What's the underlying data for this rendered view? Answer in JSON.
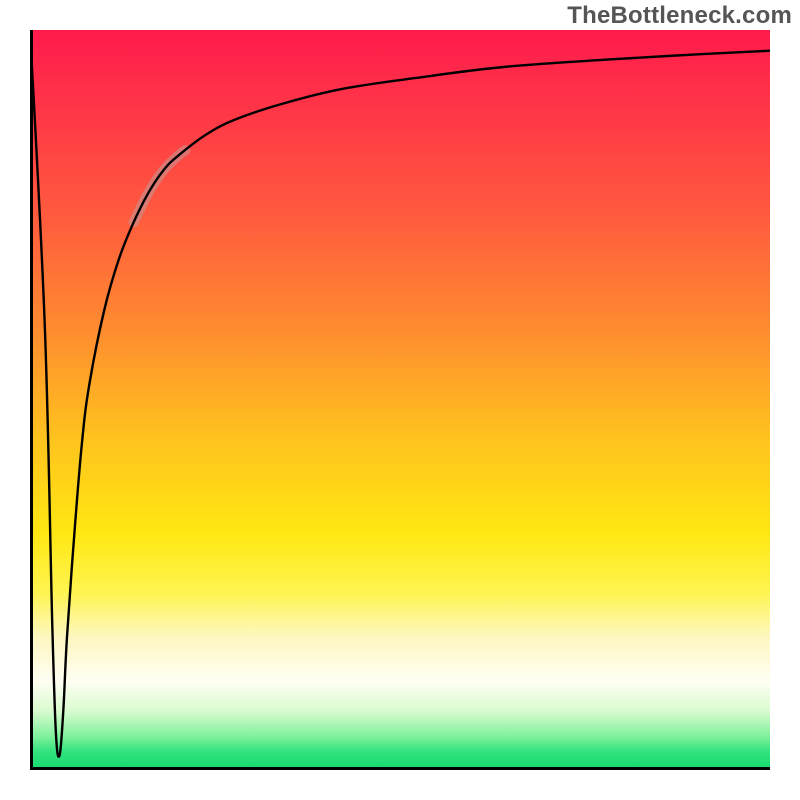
{
  "watermark": "TheBottleneck.com",
  "chart_data": {
    "type": "line",
    "title": "",
    "xlabel": "",
    "ylabel": "",
    "xlim": [
      0,
      100
    ],
    "ylim": [
      0,
      100
    ],
    "grid": false,
    "legend": false,
    "series": [
      {
        "name": "bottleneck-curve",
        "x": [
          0,
          2,
          3,
          3.5,
          4,
          4.5,
          5,
          6,
          7,
          8,
          10,
          12,
          14,
          16,
          18,
          20,
          24,
          28,
          34,
          42,
          52,
          64,
          78,
          90,
          100
        ],
        "y": [
          100,
          60,
          20,
          5,
          2,
          8,
          18,
          32,
          44,
          52,
          62,
          69,
          74,
          78,
          81,
          83,
          86,
          88,
          90,
          92,
          93.5,
          95,
          96,
          96.7,
          97.2
        ]
      }
    ],
    "annotations": [
      {
        "name": "hazy-segment",
        "x_range": [
          14,
          21
        ],
        "note": "semi-opaque rosy-brown overlay along the curve"
      }
    ],
    "background": {
      "type": "vertical-gradient",
      "stops": [
        {
          "pos": 0.0,
          "color": "#ff1a4b"
        },
        {
          "pos": 0.25,
          "color": "#ff5a3e"
        },
        {
          "pos": 0.55,
          "color": "#ffc21e"
        },
        {
          "pos": 0.76,
          "color": "#fff450"
        },
        {
          "pos": 0.88,
          "color": "#fefef2"
        },
        {
          "pos": 0.96,
          "color": "#7ef19b"
        },
        {
          "pos": 1.0,
          "color": "#14d96e"
        }
      ]
    }
  }
}
